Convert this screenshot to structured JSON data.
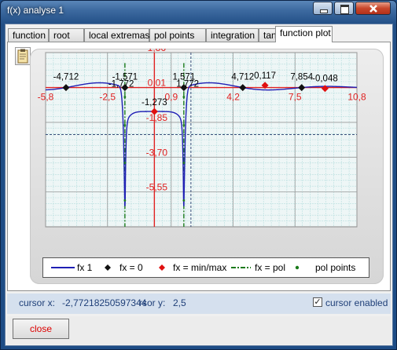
{
  "window": {
    "title": "f(x) analyse 1"
  },
  "tabs": [
    {
      "label": "function"
    },
    {
      "label": "root"
    },
    {
      "label": "local extremas"
    },
    {
      "label": "pol points"
    },
    {
      "label": "integration"
    },
    {
      "label": "tangent"
    },
    {
      "label": "function plot"
    }
  ],
  "active_tab": "function plot",
  "chart_data": {
    "type": "line",
    "xlim": [
      -5.8,
      10.8
    ],
    "ylim": [
      -7.4,
      1.86
    ],
    "x_ticks": [
      "-5,8",
      "-2,5",
      "0,9",
      "4,2",
      "7,5",
      "10,8"
    ],
    "y_ticks": [
      "1,86",
      "0,01",
      "-1,85",
      "-3,70",
      "-5,55"
    ],
    "series": [
      {
        "name": "fx 1",
        "color": "#1f1fb4"
      }
    ],
    "roots": [
      {
        "x": -4.712,
        "y": 0,
        "label": "-4,712"
      },
      {
        "x": -1.571,
        "y": 0,
        "label": "-1,571"
      },
      {
        "x": 1.571,
        "y": 0,
        "label": "1,571"
      },
      {
        "x": 4.712,
        "y": 0,
        "label": "4,712"
      },
      {
        "x": 7.854,
        "y": 0,
        "label": "7,854"
      }
    ],
    "extrema": [
      {
        "x": -1.772,
        "y": 0,
        "label": "-1,772"
      },
      {
        "x": 0,
        "y": -1.273,
        "label": "-1,273"
      },
      {
        "x": 1.772,
        "y": 0,
        "label": "1,772"
      },
      {
        "x": 5.9,
        "y": 0.117,
        "label": "0,117"
      },
      {
        "x": 9.1,
        "y": -0.048,
        "label": "-0,048"
      }
    ],
    "poles": [
      -1.571,
      1.571
    ],
    "cursor": {
      "x": -2.77218250597344,
      "y": 2.5
    },
    "legend": [
      {
        "label": "fx 1",
        "kind": "line",
        "color": "#1f1fb4"
      },
      {
        "label": "fx = 0",
        "kind": "diamond",
        "color": "#111111"
      },
      {
        "label": "fx = min/max",
        "kind": "diamond",
        "color": "#e01010"
      },
      {
        "label": "fx = pol",
        "kind": "dashdot",
        "color": "#1a7a1a"
      },
      {
        "label": "pol points",
        "kind": "dot",
        "color": "#1a7a1a"
      }
    ],
    "grid": true
  },
  "status": {
    "cursor_x_label": "cursor x:",
    "cursor_x_value": "-2,77218250597344",
    "cursor_y_label": "rsor y:",
    "cursor_y_value": "2,5",
    "cursor_enabled_label": "cursor enabled",
    "cursor_enabled": true
  },
  "buttons": {
    "close_label": "close"
  }
}
